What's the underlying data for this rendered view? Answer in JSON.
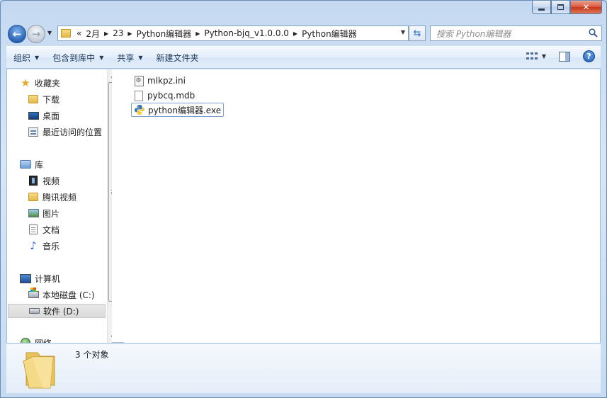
{
  "address": {
    "more": "«",
    "crumbs": [
      "2月",
      "23",
      "Python编辑器",
      "Python-bjq_v1.0.0.0",
      "Python编辑器"
    ]
  },
  "search": {
    "placeholder": "搜索 Python编辑器"
  },
  "toolbar": {
    "organize": "组织",
    "include_in_library": "包含到库中",
    "share": "共享",
    "new_folder": "新建文件夹"
  },
  "nav": {
    "favorites": {
      "label": "收藏夹",
      "items": [
        "下载",
        "桌面",
        "最近访问的位置"
      ]
    },
    "libraries": {
      "label": "库",
      "items": [
        "视频",
        "腾讯视频",
        "图片",
        "文档",
        "音乐"
      ]
    },
    "computer": {
      "label": "计算机",
      "items": [
        "本地磁盘 (C:)",
        "软件 (D:)"
      ]
    },
    "network": {
      "label": "网络"
    }
  },
  "files": [
    {
      "name": "mlkpz.ini",
      "icon": "ini-file-icon"
    },
    {
      "name": "pybcq.mdb",
      "icon": "mdb-file-icon"
    },
    {
      "name": "python编辑器.exe",
      "icon": "python-exe-icon"
    }
  ],
  "details": {
    "summary": "3 个对象"
  },
  "colors": {
    "accent": "#2a62b4",
    "selection_border": "#7da2ce"
  }
}
